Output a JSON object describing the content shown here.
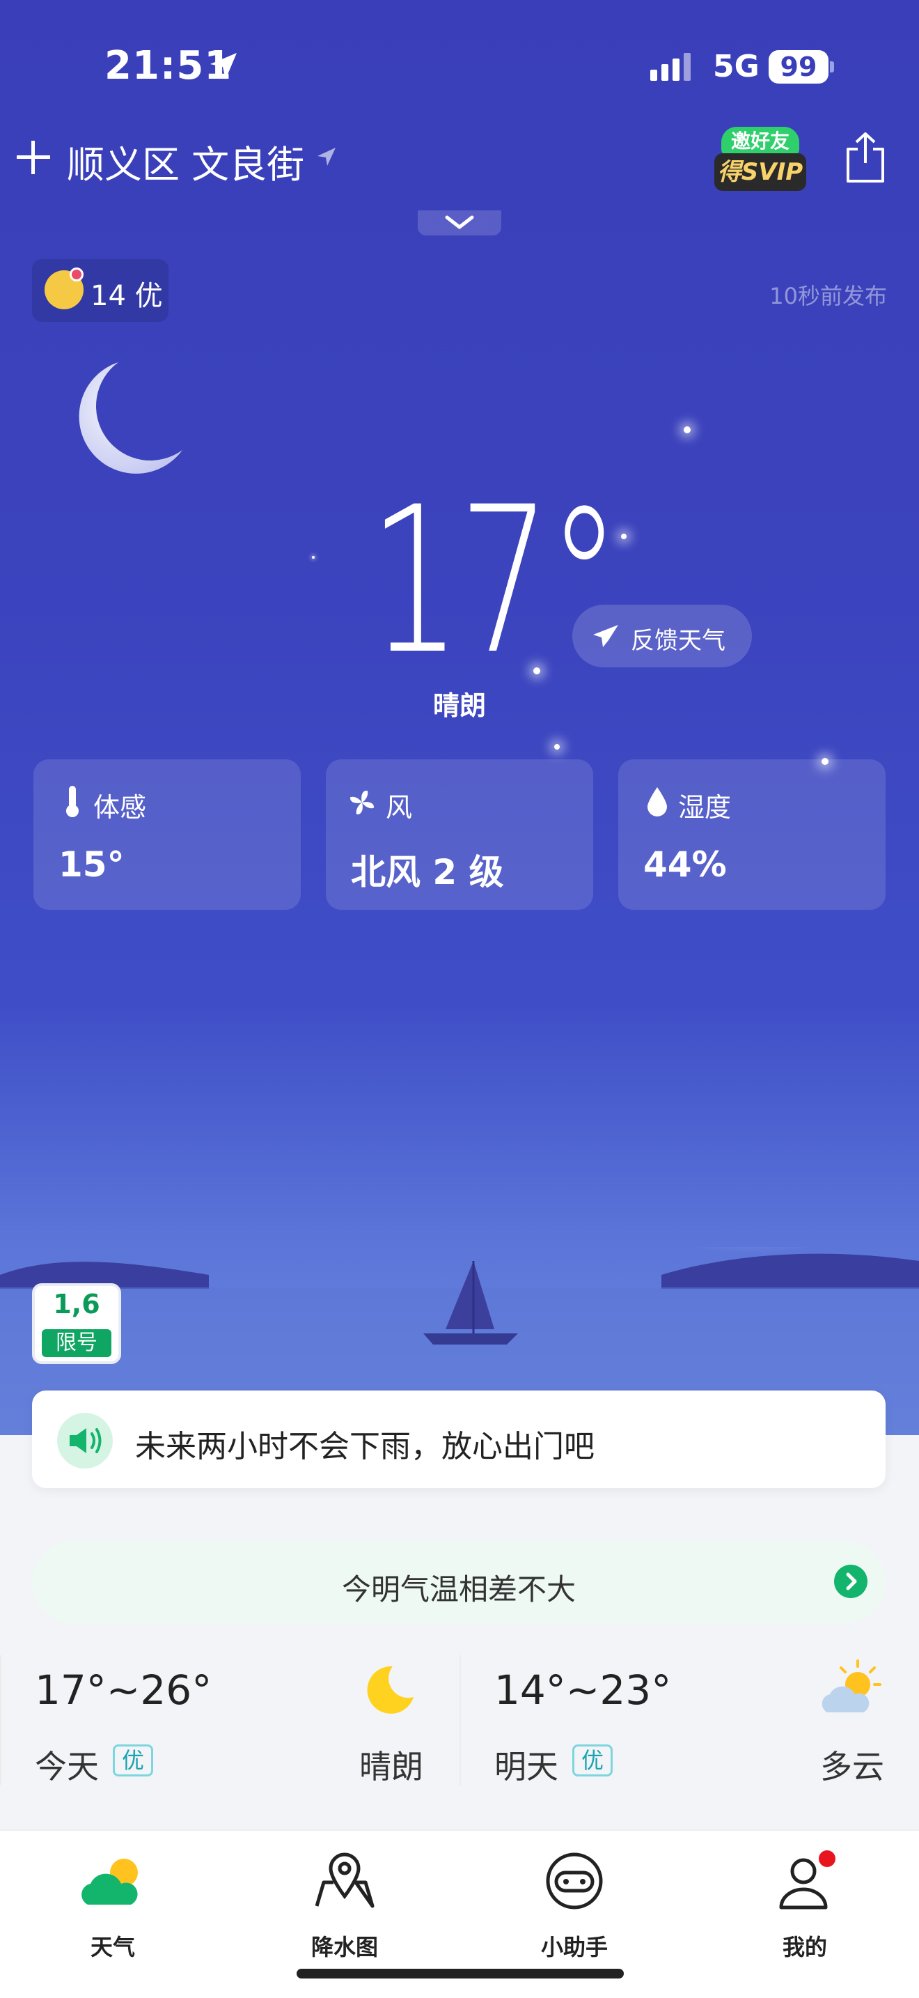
{
  "status_bar": {
    "time": "21:51",
    "network": "5G",
    "battery": "99"
  },
  "header": {
    "location": "顺义区 文良街",
    "vip_top": "邀好友",
    "vip_bottom": "得SVIP"
  },
  "air_quality": {
    "value": "14 优"
  },
  "published": "10秒前发布",
  "current": {
    "temperature": "17°",
    "condition": "晴朗",
    "feedback_label": "反馈天气"
  },
  "metrics": [
    {
      "label": "体感",
      "value": "15°"
    },
    {
      "label": "风",
      "value": "北风 2 级"
    },
    {
      "label": "湿度",
      "value": "44%"
    }
  ],
  "restriction": {
    "numbers": "1,6",
    "label": "限号"
  },
  "rain_notice": "未来两小时不会下雨，放心出门吧",
  "temp_diff": "今明气温相差不大",
  "forecast": [
    {
      "temp_range": "17°~26°",
      "day": "今天",
      "aqi": "优",
      "condition": "晴朗"
    },
    {
      "temp_range": "14°~23°",
      "day": "明天",
      "aqi": "优",
      "condition": "多云"
    }
  ],
  "tabs": [
    {
      "label": "天气"
    },
    {
      "label": "降水图"
    },
    {
      "label": "小助手"
    },
    {
      "label": "我的"
    }
  ],
  "colors": {
    "hero_top": "#3a3fb9",
    "accent_green": "#13b46b",
    "badge_teal": "#19a3b0",
    "notification_red": "#e8141e"
  }
}
